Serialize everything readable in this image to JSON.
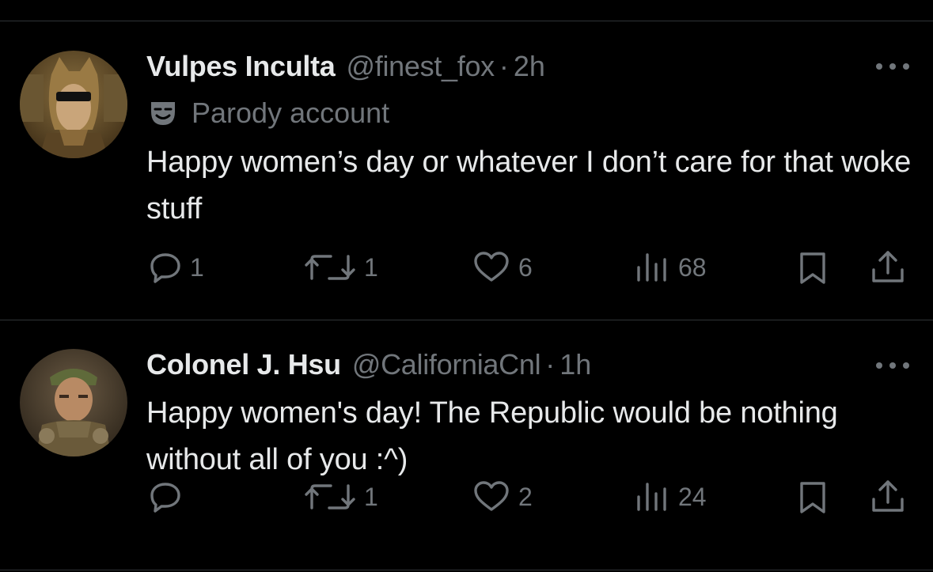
{
  "tweets": [
    {
      "name": "Vulpes Inculta",
      "handle": "@finest_fox",
      "separator": "·",
      "time": "2h",
      "badge_label": "Parody account",
      "text": "Happy women’s day or whatever I don’t care for that woke stuff",
      "replies": "1",
      "retweets": "1",
      "likes": "6",
      "views": "68"
    },
    {
      "name": "Colonel J. Hsu",
      "handle": "@CaliforniaCnl",
      "separator": "·",
      "time": "1h",
      "text": "Happy women's day! The Republic would be nothing without all of you :^)",
      "replies": "",
      "retweets": "1",
      "likes": "2",
      "views": "24"
    }
  ],
  "colors": {
    "background": "#000000",
    "primary_text": "#e7e9ea",
    "secondary_text": "#71767b",
    "divider": "#2f3336"
  },
  "icons": [
    "comment-icon",
    "retweet-icon",
    "heart-icon",
    "views-icon",
    "bookmark-icon",
    "share-icon",
    "more-icon",
    "parody-mask-icon"
  ]
}
